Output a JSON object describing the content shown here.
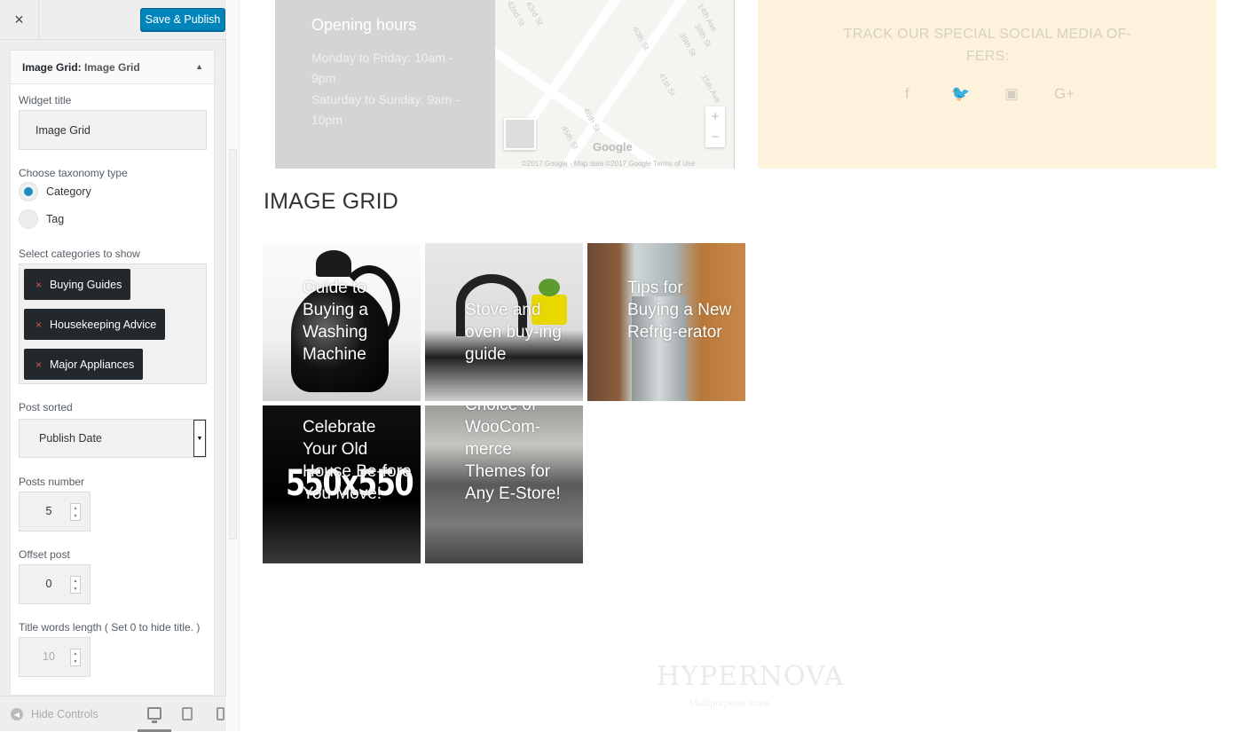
{
  "sidebar": {
    "close_icon": "×",
    "publish_label": "Save & Publish",
    "widget": {
      "title_prefix": "Image Grid:",
      "title_name": "Image Grid",
      "collapse_arrow": "▲"
    },
    "fields": {
      "widget_title_label": "Widget title",
      "widget_title_value": "Image Grid",
      "taxonomy_label": "Choose taxonomy type",
      "taxonomy_options": [
        "Category",
        "Tag"
      ],
      "taxonomy_selected": "Category",
      "categories_label": "Select categories to show",
      "categories": [
        "Buying Guides",
        "Housekeeping Advice",
        "Major Appliances"
      ],
      "category_remove_glyph": "×",
      "post_sorted_label": "Post sorted",
      "post_sorted_value": "Publish Date",
      "posts_number_label": "Posts number",
      "posts_number_value": "5",
      "offset_label": "Offset post",
      "offset_value": "0",
      "title_words_label": "Title words length ( Set 0 to hide title. )",
      "title_words_value": "10"
    },
    "footer": {
      "hide_controls_label": "Hide Controls"
    }
  },
  "preview": {
    "hours": {
      "title": "Opening hours",
      "lines": [
        "Monday to Friday: 10am - 9pm",
        "Saturday to Sunday: 9am - 10pm"
      ]
    },
    "map": {
      "street_labels": [
        "42nd St",
        "43rd St",
        "14th Ave",
        "40th St",
        "39th St",
        "38th St",
        "41st St",
        "46th St",
        "15th Ave",
        "45th St"
      ],
      "zoom_in": "+",
      "zoom_out": "−",
      "brand": "Google",
      "copyright": "©2017 Google - Map data ©2017 Google    Terms of Use"
    },
    "social": {
      "title": "TRACK OUR SPECIAL SOCIAL MEDIA OF-FERS:",
      "icons": [
        "facebook-icon",
        "twitter-icon",
        "instagram-icon",
        "google-plus-icon"
      ],
      "glyphs": [
        "f",
        "🐦",
        "▣",
        "G+"
      ]
    },
    "grid": {
      "heading": "IMAGE GRID",
      "tiles": [
        "Guide to Buying a Washing Machine",
        "Stove and oven buy-ing guide",
        "Tips for Buying a New Refrig-erator",
        "Celebrate Your Old House Be-fore You Move!",
        "Choice of WooCom-merce Themes for Any E-Store!"
      ],
      "placeholder_text": "550x550"
    },
    "footer": {
      "logo": "HYPERNOVA",
      "tagline": "Multipurpose store"
    }
  }
}
